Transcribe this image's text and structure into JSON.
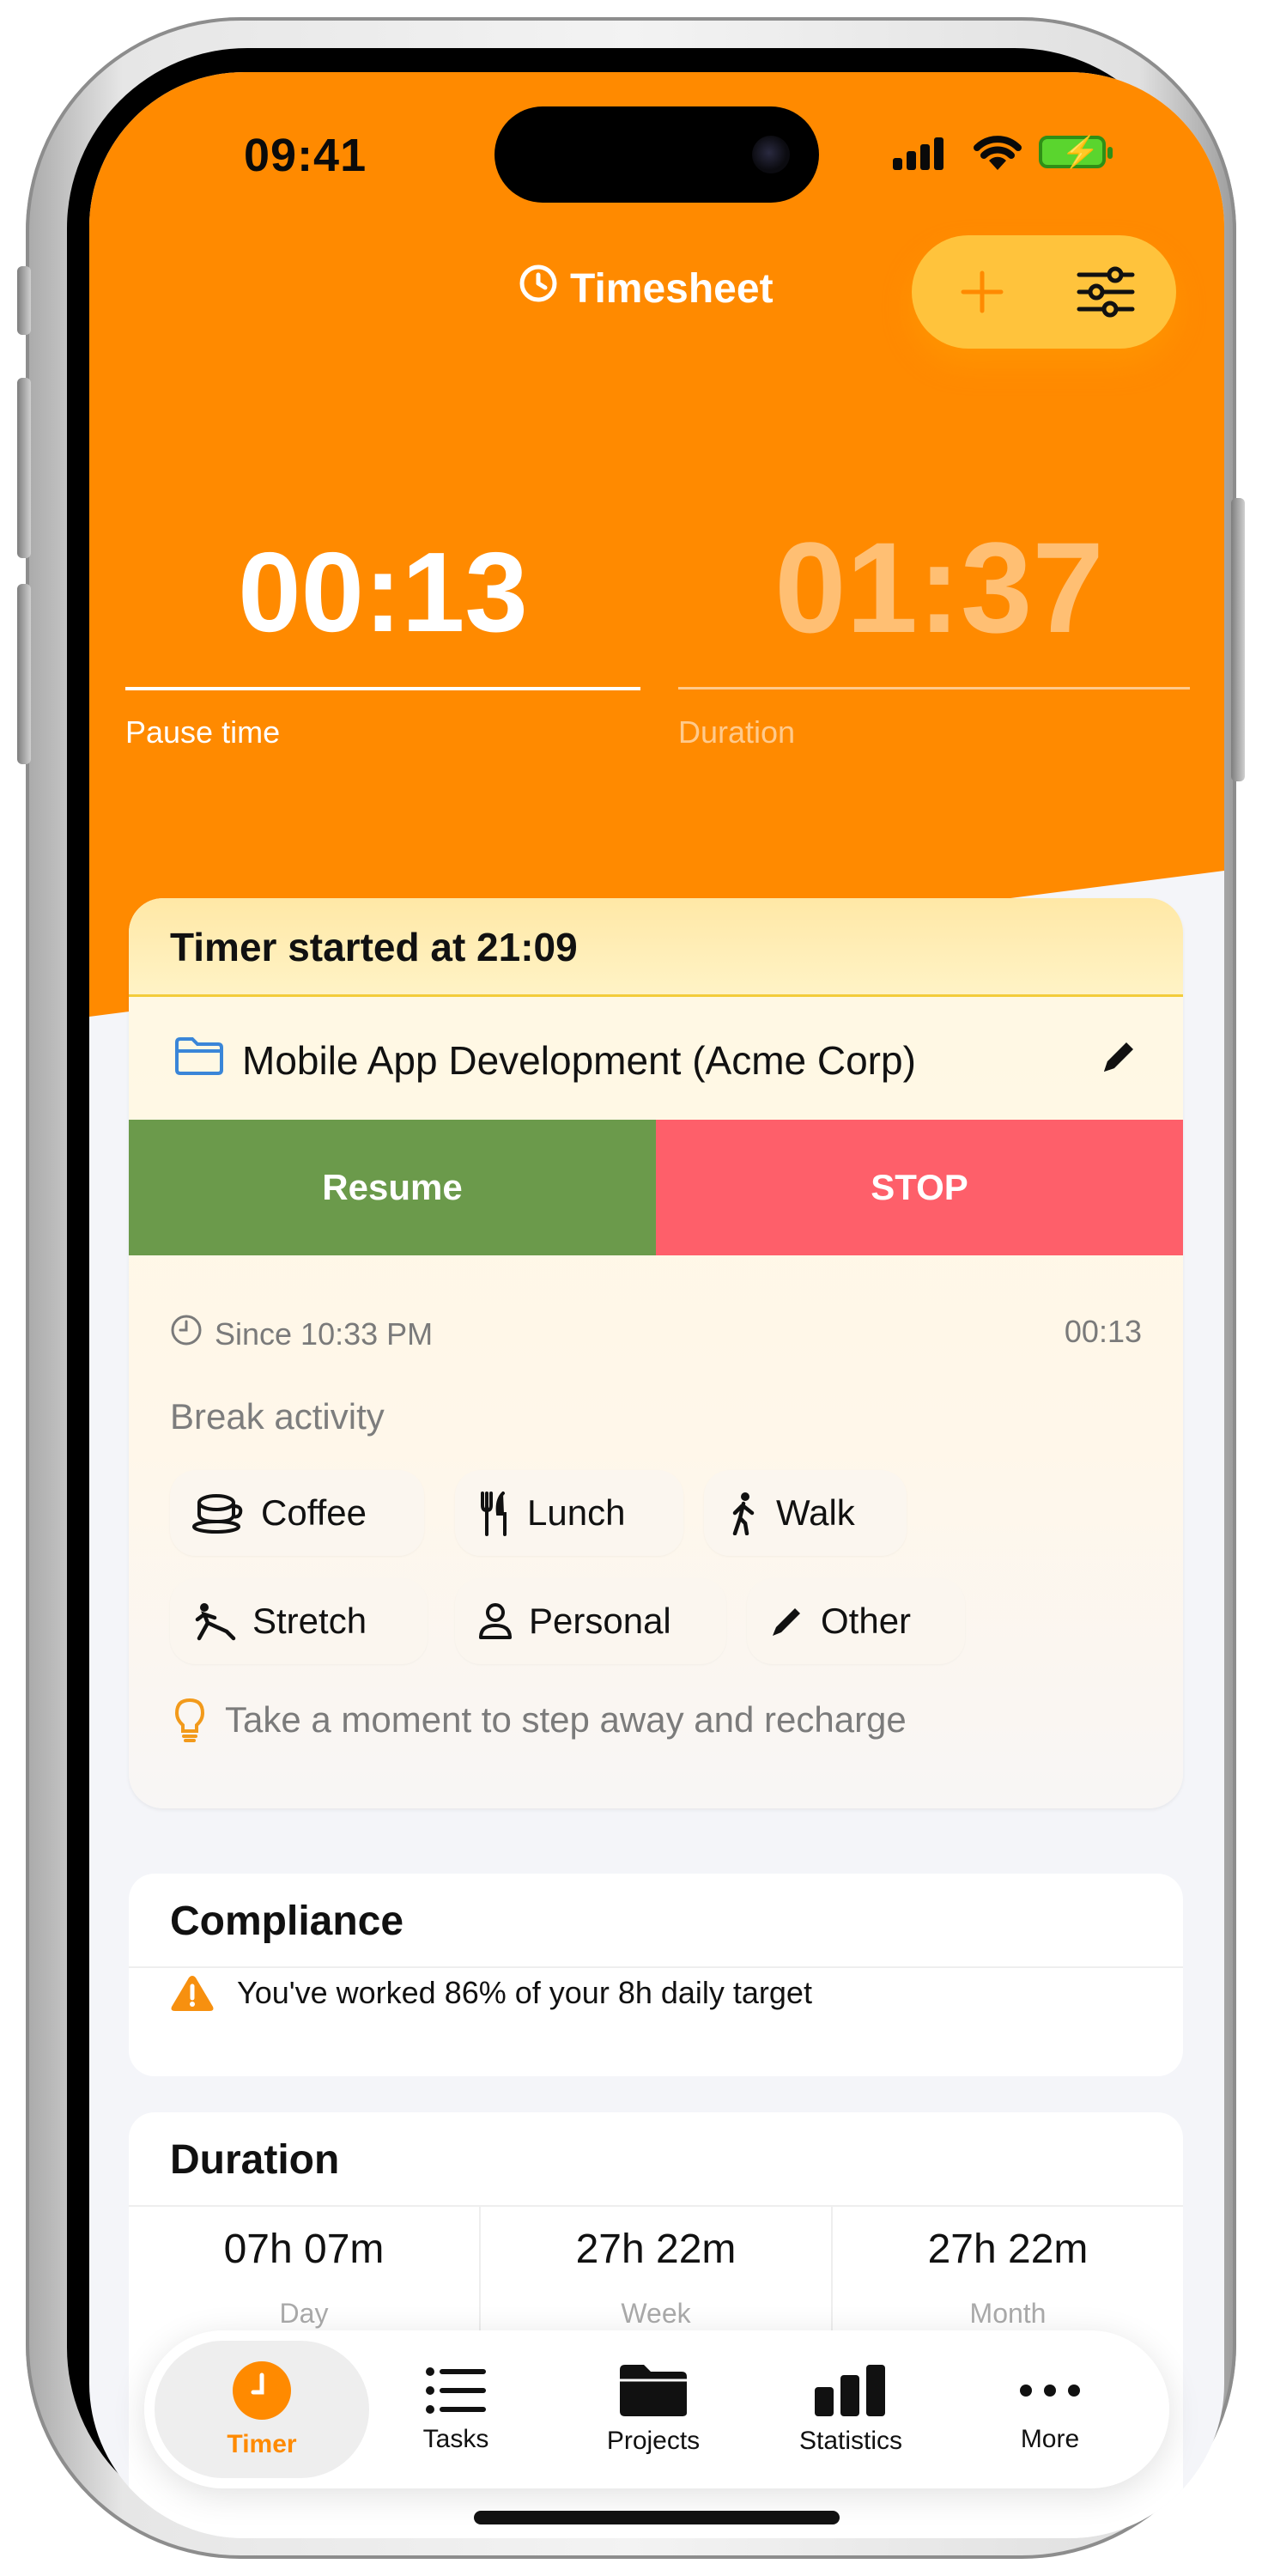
{
  "status_bar": {
    "time": "09:41"
  },
  "header": {
    "title": "Timesheet",
    "pause_time": "00:13",
    "pause_label": "Pause time",
    "duration": "01:37",
    "duration_label": "Duration"
  },
  "timer_card": {
    "started_label": "Timer started at 21:09",
    "project": "Mobile App Development (Acme Corp)",
    "resume_label": "Resume",
    "stop_label": "STOP",
    "since": "Since 10:33 PM",
    "elapsed": "00:13",
    "break_activity_label": "Break activity",
    "chips": [
      {
        "label": "Coffee",
        "icon": "coffee-cup-icon"
      },
      {
        "label": "Lunch",
        "icon": "fork-knife-icon"
      },
      {
        "label": "Walk",
        "icon": "walking-person-icon"
      },
      {
        "label": "Stretch",
        "icon": "stretching-person-icon"
      },
      {
        "label": "Personal",
        "icon": "person-icon"
      },
      {
        "label": "Other",
        "icon": "pencil-icon"
      }
    ],
    "tip": "Take a moment to step away and recharge"
  },
  "compliance": {
    "title": "Compliance",
    "message": "You've worked 86% of your 8h daily target"
  },
  "duration_section": {
    "title": "Duration",
    "stats": [
      {
        "value": "07h 07m",
        "label": "Day"
      },
      {
        "value": "27h 22m",
        "label": "Week"
      },
      {
        "value": "27h 22m",
        "label": "Month"
      }
    ]
  },
  "tabs": [
    {
      "label": "Timer",
      "active": true
    },
    {
      "label": "Tasks"
    },
    {
      "label": "Projects"
    },
    {
      "label": "Statistics"
    },
    {
      "label": "More"
    }
  ],
  "colors": {
    "header_orange": "#ff8a00",
    "accent_yellow": "#ffc33c",
    "resume_green": "#6b9a4b",
    "stop_red": "#fe5f6a",
    "active_tab": "#ff8a00"
  }
}
